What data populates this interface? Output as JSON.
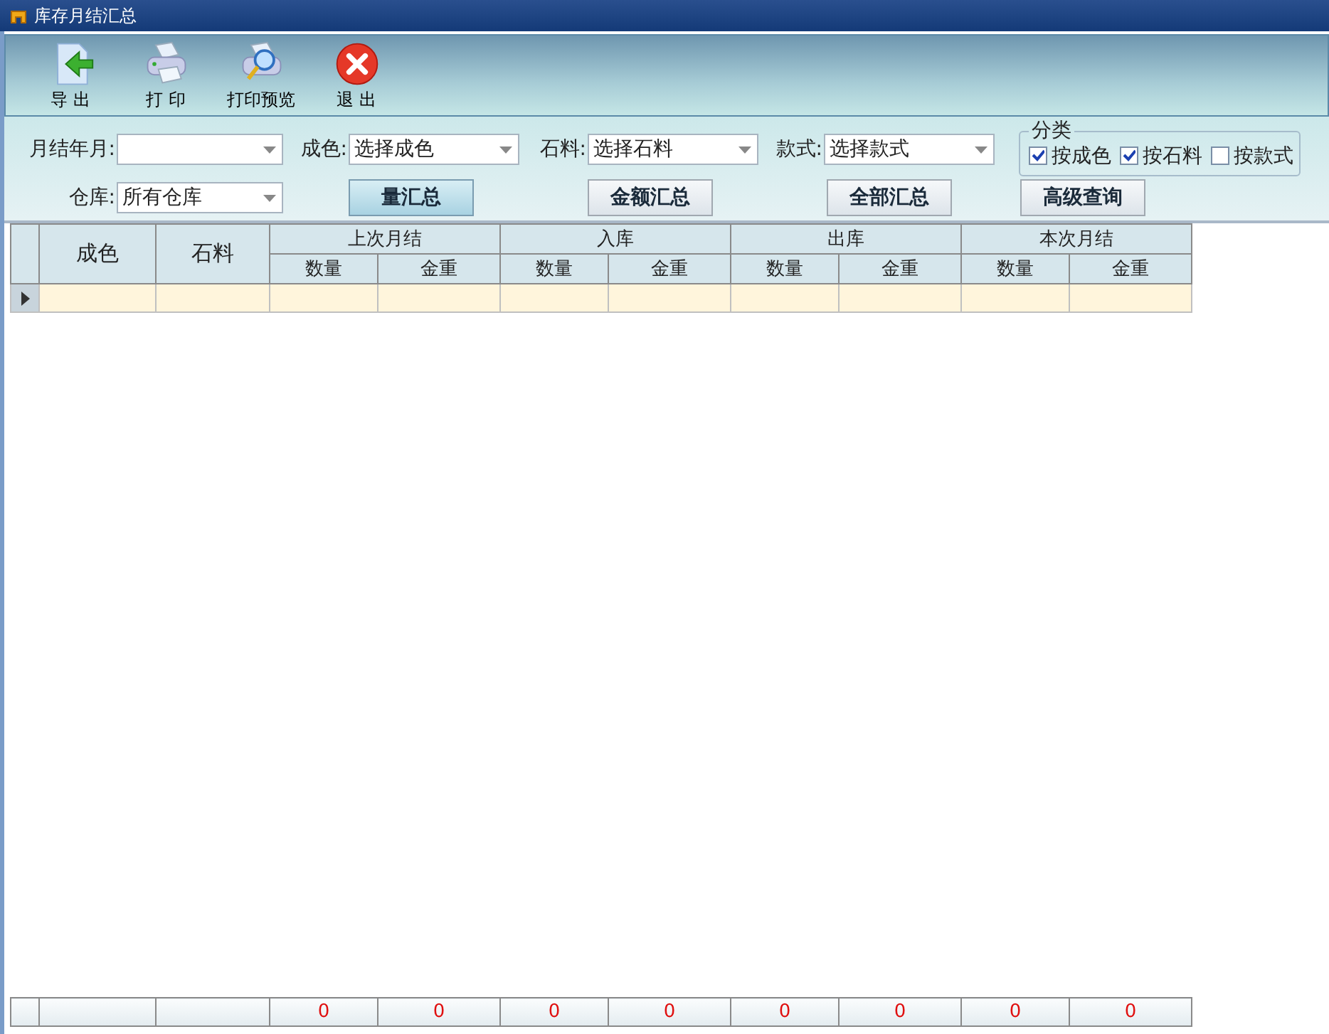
{
  "window": {
    "title": "库存月结汇总"
  },
  "toolbar": [
    {
      "kind": "export",
      "label": "导 出"
    },
    {
      "kind": "print",
      "label": "打 印"
    },
    {
      "kind": "preview",
      "label": "打印预览"
    },
    {
      "kind": "exit",
      "label": "退 出"
    }
  ],
  "filters": {
    "month": {
      "label": "月结年月:"
    },
    "color": {
      "label": "成色:",
      "value": "选择成色"
    },
    "stone": {
      "label": "石料:",
      "value": "选择石料"
    },
    "style": {
      "label": "款式:",
      "value": "选择款式"
    },
    "warehouse": {
      "label": "仓库:",
      "value": "所有仓库"
    }
  },
  "category": {
    "title": "分类",
    "options": [
      {
        "label": "按成色",
        "checked": true
      },
      {
        "label": "按石料",
        "checked": true
      },
      {
        "label": "按款式",
        "checked": false
      }
    ]
  },
  "actions": [
    {
      "label": "量汇总",
      "selected": true
    },
    {
      "label": "金额汇总",
      "selected": false
    },
    {
      "label": "全部汇总",
      "selected": false
    },
    {
      "label": "高级查询",
      "selected": false
    }
  ],
  "table": {
    "columns": [
      "成色",
      "石料"
    ],
    "groups": [
      {
        "title": "上次月结",
        "columns": [
          "数量",
          "金重"
        ]
      },
      {
        "title": "入库",
        "columns": [
          "数量",
          "金重"
        ]
      },
      {
        "title": "出库",
        "columns": [
          "数量",
          "金重"
        ]
      },
      {
        "title": "本次月结",
        "columns": [
          "数量",
          "金重"
        ]
      }
    ],
    "rows": [
      {
        "selected": true
      }
    ],
    "totals": [
      "0",
      "0",
      "0",
      "0",
      "0",
      "0",
      "0",
      "0"
    ]
  }
}
